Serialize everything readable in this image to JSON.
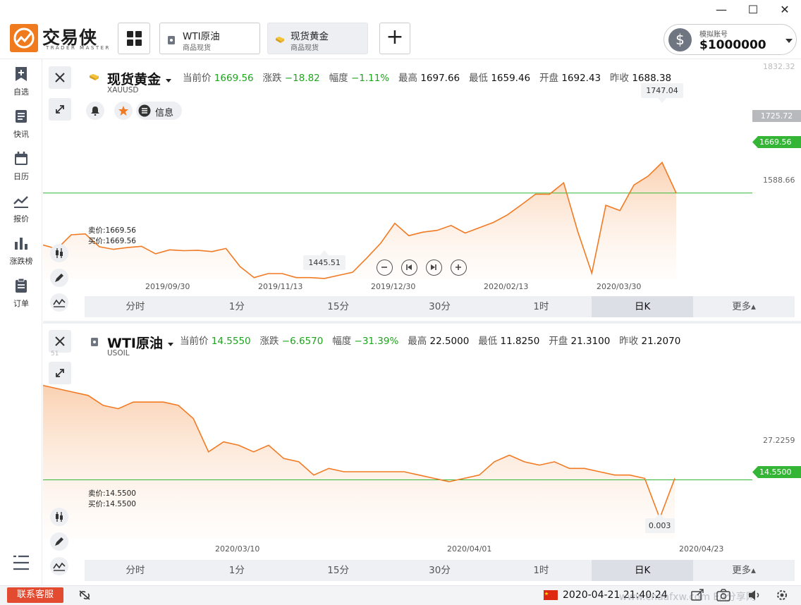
{
  "window": {
    "minimize": "—",
    "maximize": "☐",
    "close": "✕"
  },
  "brand": {
    "name": "交易侠",
    "sub": "TRADER MASTER"
  },
  "tabs": [
    {
      "name": "WTI原油",
      "type": "商品现货",
      "active": false
    },
    {
      "name": "现货黄金",
      "type": "商品现货",
      "active": true
    }
  ],
  "account": {
    "label": "模拟账号",
    "balance": "$1000000"
  },
  "sidebar": [
    {
      "label": "自选",
      "icon": "bookmark-plus-icon"
    },
    {
      "label": "快讯",
      "icon": "news-icon"
    },
    {
      "label": "日历",
      "icon": "calendar-icon"
    },
    {
      "label": "报价",
      "icon": "quote-line-icon"
    },
    {
      "label": "涨跌榜",
      "icon": "bar-rank-icon"
    },
    {
      "label": "订单",
      "icon": "order-clipboard-icon"
    }
  ],
  "gold": {
    "name": "现货黄金",
    "symbol": "XAUUSD",
    "quote": {
      "current_label": "当前价",
      "current": "1669.56",
      "change_label": "涨跌",
      "change": "−18.82",
      "pct_label": "幅度",
      "pct": "−1.11%",
      "high_label": "最高",
      "high": "1697.66",
      "low_label": "最低",
      "low": "1659.46",
      "open_label": "开盘",
      "open": "1692.43",
      "prev_label": "昨收",
      "prev": "1688.38"
    },
    "info_label": "信息",
    "sell": "卖价:1669.56",
    "buy": "买价:1669.56",
    "max_callout": "1747.04",
    "min_callout": "1445.51",
    "yaxis_top": "1832.32",
    "yaxis": [
      "1725.72",
      "1669.56",
      "1588.66"
    ],
    "dates": [
      "2019/09/30",
      "2019/11/13",
      "2019/12/30",
      "2020/02/13",
      "2020/03/30"
    ],
    "timeframes": [
      "分时",
      "1分",
      "15分",
      "30分",
      "1时",
      "日K",
      "更多▴"
    ],
    "selected": "日K"
  },
  "oil": {
    "name": "WTI原油",
    "symbol": "USOIL",
    "quote": {
      "current_label": "当前价",
      "current": "14.5550",
      "change_label": "涨跌",
      "change": "−6.6570",
      "pct_label": "幅度",
      "pct": "−31.39%",
      "high_label": "最高",
      "high": "22.5000",
      "low_label": "最低",
      "low": "11.8250",
      "open_label": "开盘",
      "open": "21.3100",
      "prev_label": "昨收",
      "prev": "21.2070"
    },
    "sell": "卖价:14.5500",
    "buy": "买价:14.5500",
    "min_callout": "0.003",
    "yaxis_top": "51",
    "yaxis": [
      "27.2259",
      "14.5500"
    ],
    "dates": [
      "2020/03/10",
      "2020/04/01",
      "2020/04/23"
    ],
    "timeframes": [
      "分时",
      "1分",
      "15分",
      "30分",
      "1时",
      "日K",
      "更多▴"
    ],
    "selected": "日K"
  },
  "status": {
    "support": "联系客服",
    "datetime": "2020-04-21 21:40:24",
    "watermark": "www.cnaafxw.com  EA分享网"
  },
  "chart_data": [
    {
      "type": "area",
      "title": "现货黄金",
      "x": [
        "2019/09/30",
        "2019/11/13",
        "2019/12/30",
        "2020/02/13",
        "2020/03/30"
      ],
      "values": [
        1552,
        1543,
        1575,
        1577,
        1548,
        1542,
        1546,
        1549,
        1532,
        1541,
        1539,
        1540,
        1537,
        1544,
        1503,
        1478,
        1487,
        1487,
        1478,
        1478,
        1476,
        1483,
        1490,
        1522,
        1556,
        1601,
        1573,
        1581,
        1585,
        1596,
        1579,
        1591,
        1603,
        1620,
        1643,
        1667,
        1667,
        1693,
        1583,
        1488,
        1642,
        1630,
        1688,
        1708,
        1739,
        1669.56
      ],
      "ylim": [
        1445.51,
        1832.32
      ],
      "current": 1669.56,
      "min_point": 1445.51,
      "max_point": 1747.04,
      "color": "#f27a23"
    },
    {
      "type": "area",
      "title": "WTI原油",
      "x": [
        "2020/03/10",
        "2020/04/01",
        "2020/04/23"
      ],
      "values": [
        43,
        42,
        41,
        40,
        37,
        36,
        38,
        38,
        38,
        37,
        33,
        23,
        26,
        25,
        23,
        25,
        21,
        20,
        16,
        18,
        17,
        17,
        17,
        17,
        17,
        16,
        15,
        14,
        15,
        16,
        20,
        22,
        20,
        19,
        20,
        18,
        18,
        17,
        16,
        16,
        15,
        3,
        15
      ],
      "ylim": [
        0,
        51
      ],
      "current": 14.555,
      "min_point": 0.003,
      "color": "#f27a23"
    }
  ]
}
